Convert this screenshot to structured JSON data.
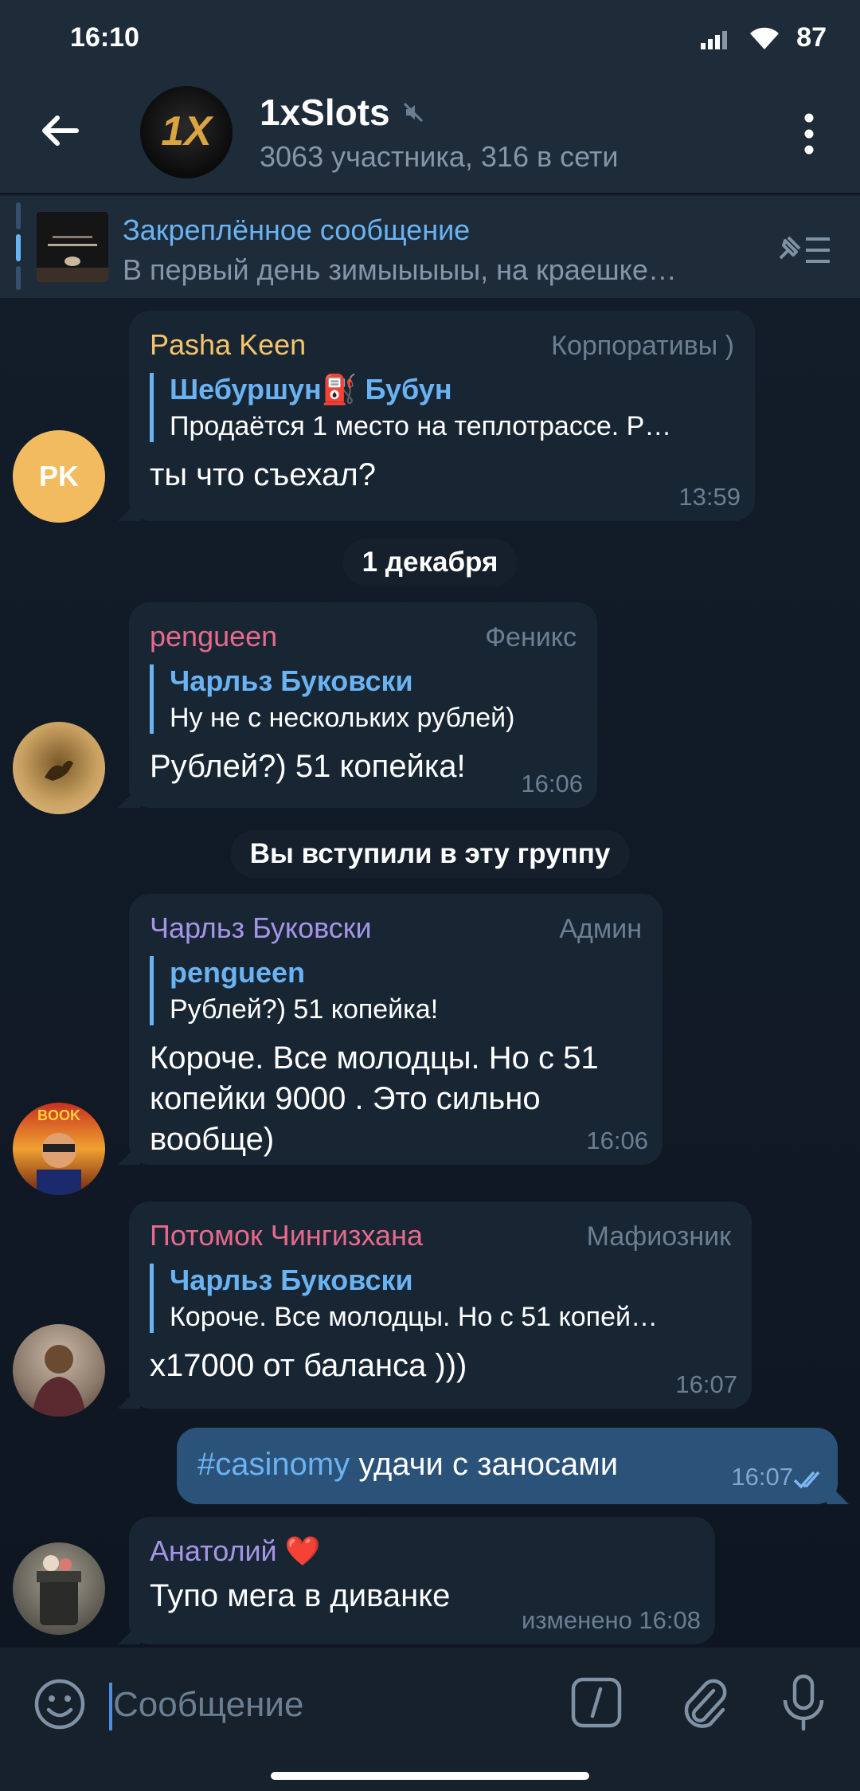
{
  "status": {
    "time": "16:10",
    "battery": "87"
  },
  "header": {
    "title": "1xSlots",
    "subtitle": "3063 участника, 316 в сети",
    "avatar_text": "1X"
  },
  "pinned": {
    "title": "Закреплённое сообщение",
    "text": "В первый день зимыыыыы, на краешке…"
  },
  "colors": {
    "header_bg": "#1e2c3a",
    "chat_bg": "#0e1621",
    "bubble_bg": "#182533",
    "own_bubble_bg": "#2b5278",
    "link": "#6ab3f3",
    "muted": "#6b7f93"
  },
  "messages": [
    {
      "avatar_initials": "PK",
      "sender": "Pasha Keen",
      "sender_color": "#f5c46a",
      "role": "Корпоративы )",
      "reply_name": "Шебуршун⛽ Бубун",
      "reply_text": "Продаётся 1 место на теплотрассе. Р…",
      "text": "ты что съехал?",
      "time": "13:59"
    },
    {
      "sender": "pengueen",
      "sender_color": "#e56a8c",
      "role": "Феникс",
      "reply_name": "Чарльз Буковски",
      "reply_text": "Ну не с нескольких рублей)",
      "text": "Рублей?) 51 копейка!",
      "time": "16:06"
    },
    {
      "sender": "Чарльз Буковски",
      "sender_color": "#a695e7",
      "role": "Админ",
      "reply_name": "pengueen",
      "reply_text": "Рублей?) 51 копейка!",
      "text": "Короче. Все молодцы. Но с 51 копейки 9000 . Это сильно вообще)",
      "time": "16:06"
    },
    {
      "sender": "Потомок Чингизхана",
      "sender_color": "#e56a8c",
      "role": "Мафиозник",
      "reply_name": "Чарльз Буковски",
      "reply_text": "Короче. Все молодцы. Но с 51 копей…",
      "text": "x17000  от баланса )))",
      "time": "16:07"
    },
    {
      "sender": "Анатолий ❤️",
      "sender_color": "#a695e7",
      "text": "Тупо мега в диванке",
      "time": "изменено 16:08"
    }
  ],
  "date_divider": "1 декабря",
  "service_message": "Вы вступили в эту группу",
  "own_message": {
    "hashtag": "#casinomy",
    "text": " удачи с заносами",
    "time": "16:07"
  },
  "input": {
    "placeholder": "Сообщение"
  },
  "icons": {
    "back": "arrow-left-icon",
    "mute": "muted-speaker-icon",
    "menu": "more-vertical-icon",
    "pinned_list": "pin-list-icon",
    "emoji": "emoji-icon",
    "commands": "slash-command-icon",
    "attach": "paperclip-icon",
    "mic": "microphone-icon",
    "read": "double-check-icon"
  }
}
